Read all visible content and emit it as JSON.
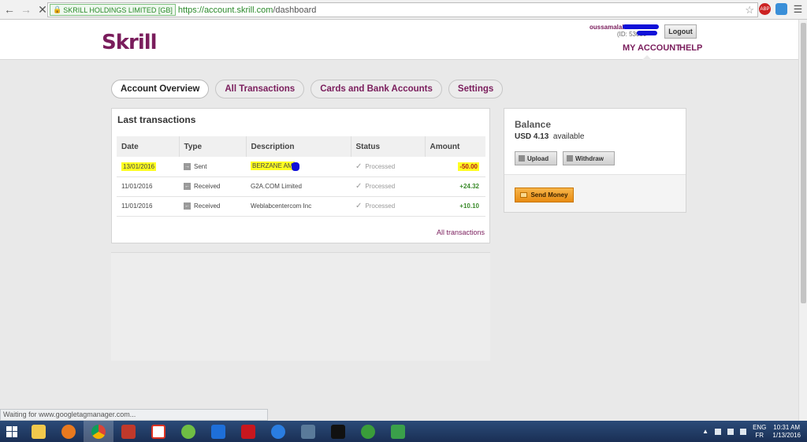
{
  "browser": {
    "ev_label": "SKRILL HOLDINGS LIMITED [GB]",
    "url_scheme_host": "https://account.skrill.com",
    "url_path": "/dashboard",
    "abp_label": "ABP",
    "status_text": "Waiting for www.googletagmanager.com..."
  },
  "header": {
    "logo": "Skrill",
    "user_name": "oussamalall",
    "user_id": "(ID: 53030",
    "logout": "Logout",
    "my_account": "MY ACCOUNT",
    "help": "HELP"
  },
  "tabs": [
    {
      "label": "Account Overview",
      "active": true
    },
    {
      "label": "All Transactions",
      "active": false
    },
    {
      "label": "Cards and Bank Accounts",
      "active": false
    },
    {
      "label": "Settings",
      "active": false
    }
  ],
  "transactions": {
    "title": "Last transactions",
    "columns": [
      "Date",
      "Type",
      "Description",
      "Status",
      "Amount"
    ],
    "rows": [
      {
        "date": "13/01/2016",
        "type": "Sent",
        "type_icon": "arrow-right-icon",
        "description": "BERZANE AM",
        "status": "Processed",
        "amount": "-50.00",
        "highlighted": true
      },
      {
        "date": "11/01/2016",
        "type": "Received",
        "type_icon": "arrow-left-icon",
        "description": "G2A.COM Limited",
        "status": "Processed",
        "amount": "+24.32",
        "highlighted": false
      },
      {
        "date": "11/01/2016",
        "type": "Received",
        "type_icon": "arrow-left-icon",
        "description": "Weblabcentercom Inc",
        "status": "Processed",
        "amount": "+10.10",
        "highlighted": false
      }
    ],
    "all_link": "All transactions"
  },
  "balance": {
    "title": "Balance",
    "amount": "USD 4.13",
    "suffix": "available",
    "upload": "Upload",
    "withdraw": "Withdraw",
    "send_money": "Send Money"
  },
  "taskbar": {
    "lang_top": "ENG",
    "lang_bottom": "FR",
    "time": "10:31 AM",
    "date": "1/13/2016"
  },
  "colors": {
    "brand": "#7a1d5c",
    "highlight": "#ffff22",
    "positive": "#3a8a2a",
    "negative": "#b51818",
    "send_button": "#f0a030"
  }
}
